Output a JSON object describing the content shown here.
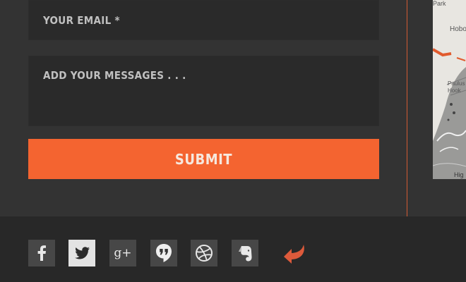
{
  "form": {
    "email_placeholder": "YOUR EMAIL *",
    "message_placeholder": "ADD YOUR MESSAGES . . .",
    "submit_label": "SUBMIT"
  },
  "map": {
    "labels": [
      "Park",
      "Hobo",
      "Paulus",
      "Hook",
      "Hig"
    ]
  },
  "social": {
    "icons": [
      "facebook-icon",
      "twitter-icon",
      "google-plus-icon",
      "hangouts-icon",
      "dribbble-icon",
      "evernote-icon",
      "back-arrow-icon"
    ],
    "google_plus_text": "g+"
  },
  "colors": {
    "accent": "#f46430",
    "background": "#333333",
    "field": "#2a2a2a",
    "footer": "#282828",
    "divider": "#d25a32",
    "icon_tile": "#454545"
  }
}
